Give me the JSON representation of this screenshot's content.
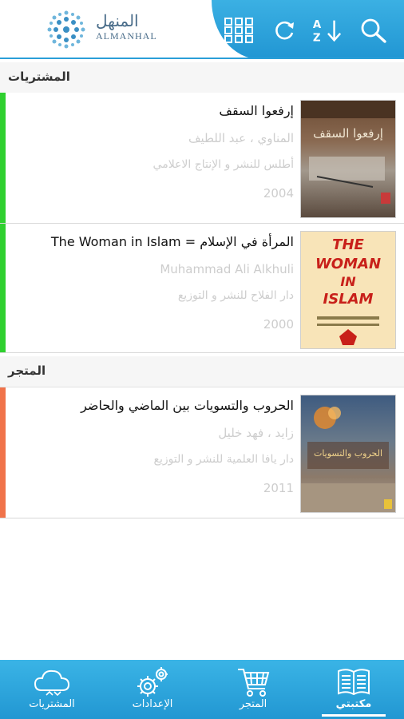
{
  "header": {
    "logo_arabic": "المنهل",
    "logo_english": "ALMANHAL",
    "logo_tagline": "",
    "icons": [
      "grid-icon",
      "refresh-icon",
      "sort-az-icon",
      "search-icon"
    ]
  },
  "sections": {
    "purchases_title": "المشتريات",
    "store_title": "المتجر"
  },
  "books": [
    {
      "title": "إرفعوا السقف",
      "author": "المناوي ، عبد اللطيف",
      "publisher": "أطلس للنشر و الإنتاج الاعلامي",
      "year": "2004",
      "status_color": "#2fd02f"
    },
    {
      "title": "المرأة في الإسلام = The Woman in Islam",
      "author": "Muhammad Ali Alkhuli",
      "publisher": "دار الفلاح للنشر و التوزيع",
      "year": "2000",
      "status_color": "#2fd02f",
      "cover_text": [
        "THE",
        "WOMAN",
        "IN",
        "ISLAM"
      ]
    },
    {
      "title": "الحروب والتسويات بين الماضي والحاضر",
      "author": "زايد ، فهد خليل",
      "publisher": "دار يافا العلمية للنشر و التوزيع",
      "year": "2011",
      "status_color": "#f0734a"
    }
  ],
  "nav": {
    "items": [
      {
        "label": "مكتبتي",
        "icon": "book-icon",
        "active": true
      },
      {
        "label": "المتجر",
        "icon": "cart-icon",
        "active": false
      },
      {
        "label": "الإعدادات",
        "icon": "gears-icon",
        "active": false
      },
      {
        "label": "المشتريات",
        "icon": "cloud-icon",
        "active": false
      }
    ]
  },
  "colors": {
    "accent": "#2a9fd8",
    "purchased": "#2fd02f",
    "store": "#f0734a"
  }
}
